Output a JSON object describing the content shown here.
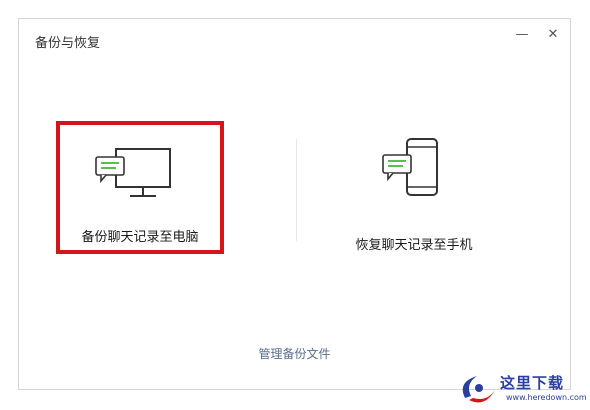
{
  "window": {
    "title": "备份与恢复",
    "minimize_glyph": "—",
    "close_glyph": "✕"
  },
  "options": [
    {
      "label": "备份聊天记录至电脑",
      "icon": "computer-chat-icon",
      "selected": true
    },
    {
      "label": "恢复聊天记录至手机",
      "icon": "phone-chat-icon",
      "selected": false
    }
  ],
  "footer": {
    "manage_label": "管理备份文件"
  },
  "watermark": {
    "text": "这里下载",
    "url": "www.heredown.com"
  },
  "colors": {
    "highlight": "#d6141c",
    "icon_green": "#5bbf4e",
    "link": "#5a6f8c"
  }
}
